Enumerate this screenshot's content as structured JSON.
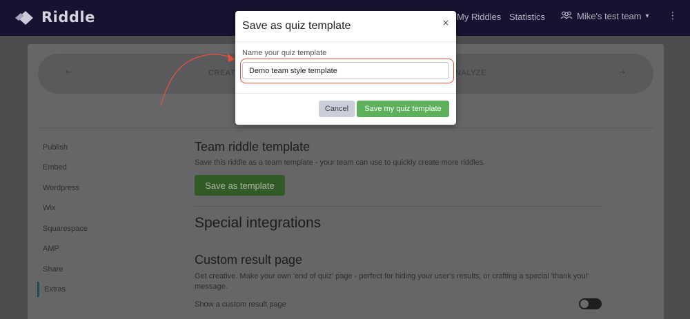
{
  "app": {
    "logo_text": "Riddle"
  },
  "nav": {
    "my_riddles": "My Riddles",
    "statistics": "Statistics",
    "team_name": "Mike's test team",
    "team_caret": "▾",
    "more": "⋮"
  },
  "stepper": {
    "prev_arrow": "←",
    "next_arrow": "→",
    "left_label": "CREATE",
    "right_label": "NALYZE"
  },
  "sidebar": {
    "items": [
      {
        "label": "Publish"
      },
      {
        "label": "Embed"
      },
      {
        "label": "Wordpress"
      },
      {
        "label": "Wix"
      },
      {
        "label": "Squarespace"
      },
      {
        "label": "AMP"
      },
      {
        "label": "Share"
      },
      {
        "label": "Extras"
      }
    ],
    "active": "Extras"
  },
  "main": {
    "team_template_heading": "Team riddle template",
    "team_template_desc": "Save this riddle as a team template - your team can use to quickly create more riddles.",
    "save_as_template_button": "Save as template",
    "special_integrations_heading": "Special integrations",
    "custom_result_heading": "Custom result page",
    "custom_result_desc": "Get creative. Make your own 'end of quiz' page - perfect for hiding your user's results, or crafting a special 'thank you!' message.",
    "show_custom_result_label": "Show a custom result page",
    "show_custom_result_enabled": false
  },
  "modal": {
    "title": "Save as quiz template",
    "close": "×",
    "field_label": "Name your quiz template",
    "field_value": "Demo team style template",
    "cancel_button": "Cancel",
    "save_button": "Save my quiz template"
  },
  "colors": {
    "accent_green": "#5cb15a",
    "highlight_red": "#e2533b",
    "nav_bg": "#17122f"
  }
}
